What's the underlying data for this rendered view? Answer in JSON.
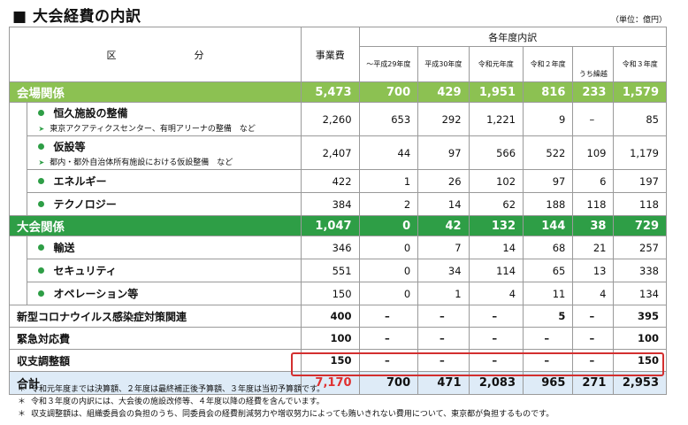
{
  "title": "大会経費の内訳",
  "unit": "（単位：億円）",
  "header": {
    "kubun": "区　　　　　　　　分",
    "jigyohi": "事業費",
    "group": "各年度内訳",
    "years": [
      "～平成29年度",
      "平成30年度",
      "令和元年度",
      "令和２年度",
      "うち繰越",
      "令和３年度"
    ]
  },
  "rows": {
    "venue": {
      "label": "会場関係",
      "values": [
        "5,473",
        "700",
        "429",
        "1,951",
        "816",
        "233",
        "1,579"
      ]
    },
    "permanent": {
      "label": "恒久施設の整備",
      "note": "東京アクアティクスセンター、有明アリーナの整備　など",
      "values": [
        "2,260",
        "653",
        "292",
        "1,221",
        "9",
        "–",
        "85"
      ]
    },
    "temporary": {
      "label": "仮設等",
      "note": "都内・都外自治体所有施設における仮設整備　など",
      "values": [
        "2,407",
        "44",
        "97",
        "566",
        "522",
        "109",
        "1,179"
      ]
    },
    "energy": {
      "label": "エネルギー",
      "values": [
        "422",
        "1",
        "26",
        "102",
        "97",
        "6",
        "197"
      ]
    },
    "technology": {
      "label": "テクノロジー",
      "values": [
        "384",
        "2",
        "14",
        "62",
        "188",
        "118",
        "118"
      ]
    },
    "games": {
      "label": "大会関係",
      "values": [
        "1,047",
        "0",
        "42",
        "132",
        "144",
        "38",
        "729"
      ]
    },
    "transport": {
      "label": "輸送",
      "values": [
        "346",
        "0",
        "7",
        "14",
        "68",
        "21",
        "257"
      ]
    },
    "security": {
      "label": "セキュリティ",
      "values": [
        "551",
        "0",
        "34",
        "114",
        "65",
        "13",
        "338"
      ]
    },
    "operations": {
      "label": "オペレーション等",
      "values": [
        "150",
        "0",
        "1",
        "4",
        "11",
        "4",
        "134"
      ]
    },
    "covid": {
      "label": "新型コロナウイルス感染症対策関連",
      "values": [
        "400",
        "–",
        "–",
        "–",
        "5",
        "–",
        "395"
      ]
    },
    "emergency": {
      "label": "緊急対応費",
      "values": [
        "100",
        "–",
        "–",
        "–",
        "–",
        "–",
        "100"
      ]
    },
    "adjust": {
      "label": "収支調整額",
      "values": [
        "150",
        "–",
        "–",
        "–",
        "–",
        "–",
        "150"
      ]
    },
    "total": {
      "label": "合計",
      "values": [
        "7,170",
        "700",
        "471",
        "2,083",
        "965",
        "271",
        "2,953"
      ]
    }
  },
  "footnotes": [
    "令和元年度までは決算額、２年度は最終補正後予算額、３年度は当初予算額です。",
    "令和３年度の内訳には、大会後の施設改修等、４年度以降の経費を含んでいます。",
    "収支調整額は、組織委員会の負担のうち、同委員会の経費削減努力や増収努力によっても賄いきれない費用について、東京都が負担するものです。"
  ],
  "footnote_mark": "＊",
  "colors": {
    "light_green": "#8cc152",
    "dark_green": "#2e9e46",
    "total_bg": "#deebf7",
    "highlight": "#d32f2f"
  }
}
